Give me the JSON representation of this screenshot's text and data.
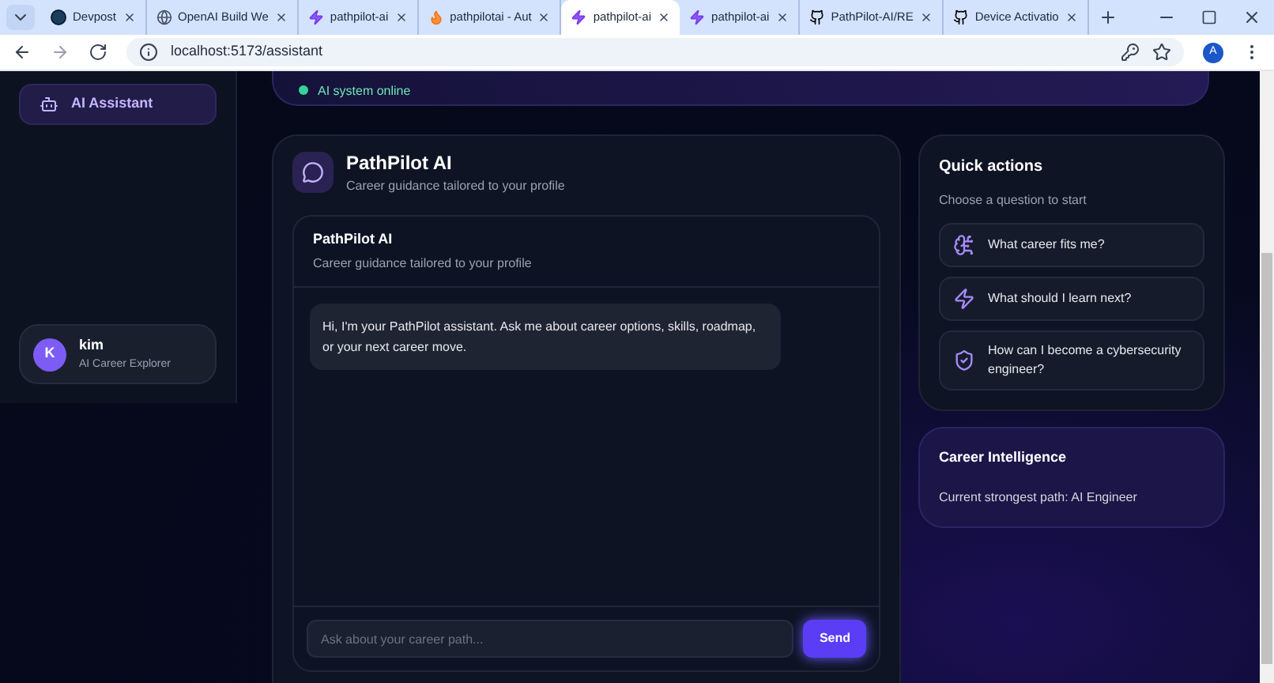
{
  "browser": {
    "tabs": [
      {
        "title": "Devpost",
        "kind": "devpost",
        "selected": false
      },
      {
        "title": "OpenAI Build We",
        "kind": "globe",
        "selected": false
      },
      {
        "title": "pathpilot-ai",
        "kind": "bolt",
        "selected": false
      },
      {
        "title": "pathpilotai - Aut",
        "kind": "fire",
        "selected": false
      },
      {
        "title": "pathpilot-ai",
        "kind": "bolt",
        "selected": true
      },
      {
        "title": "pathpilot-ai",
        "kind": "bolt",
        "selected": false
      },
      {
        "title": "PathPilot-AI/RE",
        "kind": "github",
        "selected": false
      },
      {
        "title": "Device Activatio",
        "kind": "github",
        "selected": false
      }
    ],
    "url": "localhost:5173/assistant",
    "profile_initial": "A"
  },
  "sidebar": {
    "items": [
      {
        "label": "AI Assistant",
        "selected": true
      }
    ],
    "user": {
      "initial": "K",
      "name": "kim",
      "role": "AI Career Explorer"
    }
  },
  "status": {
    "label": "AI system online"
  },
  "chat": {
    "title": "PathPilot AI",
    "subtitle": "Career guidance tailored to your profile",
    "panel_title": "PathPilot AI",
    "panel_subtitle": "Career guidance tailored to your profile",
    "messages": [
      "Hi, I'm your PathPilot assistant. Ask me about career options, skills, roadmap, or your next career move."
    ],
    "input": {
      "placeholder": "Ask about your career path..."
    },
    "send": "Send"
  },
  "quick_actions": {
    "title": "Quick actions",
    "subtitle": "Choose a question to start",
    "items": [
      {
        "label": "What career fits me?",
        "kind": "career"
      },
      {
        "label": "What should I learn next?",
        "kind": "learn"
      },
      {
        "label": "How can I become a cybersecurity engineer?",
        "kind": "security"
      }
    ]
  },
  "intelligence": {
    "title": "Career Intelligence",
    "text": "Current strongest path: AI Engineer"
  }
}
